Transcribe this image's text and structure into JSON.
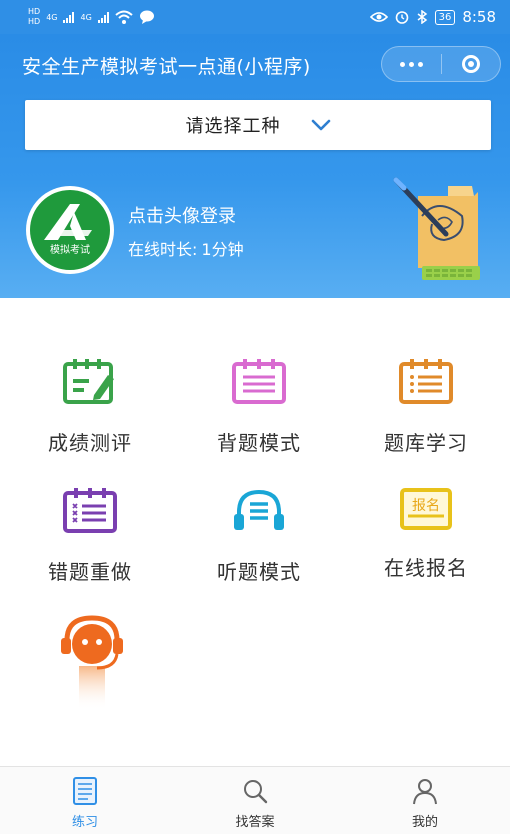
{
  "status_bar": {
    "net_top": "HD",
    "net_bottom": "HD",
    "net_type_1": "4G",
    "net_type_2": "4G",
    "battery": "36",
    "time": "8:58"
  },
  "header": {
    "title": "安全生产模拟考试一点通(小程序)",
    "capsule_more_icon": "more-dots-icon",
    "capsule_close_icon": "target-icon"
  },
  "selector": {
    "label": "请选择工种",
    "icon": "chevron-down-icon"
  },
  "user": {
    "avatar_text": "模拟考试",
    "login_prompt": "点击头像登录",
    "online_label": "在线时长:",
    "online_value": "1分钟"
  },
  "menu": [
    {
      "label": "成绩测评",
      "icon": "scorecard-edit-icon",
      "color": "#3aa34a"
    },
    {
      "label": "背题模式",
      "icon": "list-note-icon",
      "color": "#d96bd0"
    },
    {
      "label": "题库学习",
      "icon": "list-note-icon",
      "color": "#e08a2a"
    },
    {
      "label": "错题重做",
      "icon": "wrong-list-icon",
      "color": "#7a3fb0"
    },
    {
      "label": "听题模式",
      "icon": "headphones-icon",
      "color": "#1aa6d6"
    },
    {
      "label": "在线报名",
      "icon": "signup-badge-icon",
      "color": "#e8c21a",
      "badge": "报名"
    }
  ],
  "service": {
    "icon": "customer-service-icon",
    "color": "#ee6a1f"
  },
  "tabbar": [
    {
      "label": "练习",
      "icon": "practice-doc-icon",
      "active": true
    },
    {
      "label": "找答案",
      "icon": "search-icon",
      "active": false
    },
    {
      "label": "我的",
      "icon": "user-icon",
      "active": false
    }
  ],
  "colors": {
    "primary": "#2f8fe6",
    "avatar_green": "#1f9a3c"
  }
}
